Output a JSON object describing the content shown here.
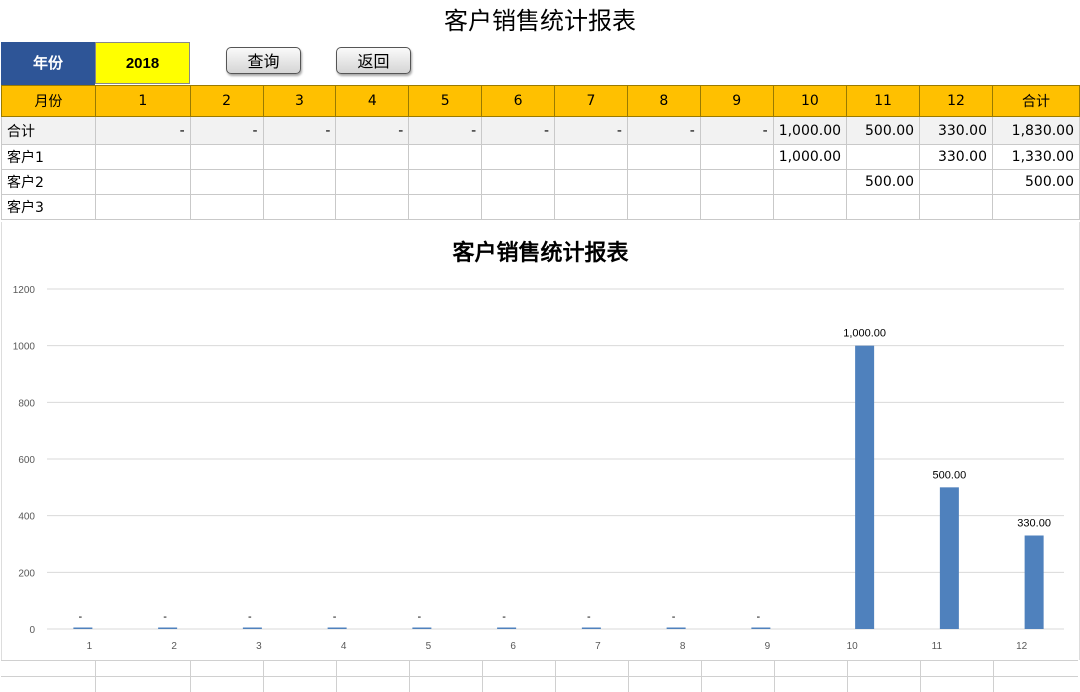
{
  "page_title": "客户销售统计报表",
  "year": {
    "label": "年份",
    "value": "2018"
  },
  "buttons": {
    "query": "查询",
    "back": "返回"
  },
  "table": {
    "header": [
      "月份",
      "1",
      "2",
      "3",
      "4",
      "5",
      "6",
      "7",
      "8",
      "9",
      "10",
      "11",
      "12",
      "合计"
    ],
    "rows": [
      {
        "cells": [
          "合计",
          "-",
          "-",
          "-",
          "-",
          "-",
          "-",
          "-",
          "-",
          "-",
          "1,000.00",
          "500.00",
          "330.00",
          "1,830.00"
        ]
      },
      {
        "cells": [
          "客户1",
          "",
          "",
          "",
          "",
          "",
          "",
          "",
          "",
          "",
          "1,000.00",
          "",
          "330.00",
          "1,330.00"
        ]
      },
      {
        "cells": [
          "客户2",
          "",
          "",
          "",
          "",
          "",
          "",
          "",
          "",
          "",
          "",
          "500.00",
          "",
          "500.00"
        ]
      },
      {
        "cells": [
          "客户3",
          "",
          "",
          "",
          "",
          "",
          "",
          "",
          "",
          "",
          "",
          "",
          "",
          ""
        ]
      }
    ]
  },
  "chart_data": {
    "type": "bar",
    "title": "客户销售统计报表",
    "categories": [
      "1",
      "2",
      "3",
      "4",
      "5",
      "6",
      "7",
      "8",
      "9",
      "10",
      "11",
      "12"
    ],
    "values": [
      0,
      0,
      0,
      0,
      0,
      0,
      0,
      0,
      0,
      1000,
      500,
      330
    ],
    "data_labels": [
      "-",
      "-",
      "-",
      "-",
      "-",
      "-",
      "-",
      "-",
      "-",
      "1,000.00",
      "500.00",
      "330.00"
    ],
    "ylim": [
      0,
      1200
    ],
    "yticks": [
      0,
      200,
      400,
      600,
      800,
      1000,
      1200
    ],
    "grid": true,
    "bar_color": "#4f81bd",
    "xlabel": "",
    "ylabel": ""
  },
  "colors": {
    "header": "#ffc000",
    "year_label": "#2e5597",
    "year_value": "#ffff00"
  }
}
